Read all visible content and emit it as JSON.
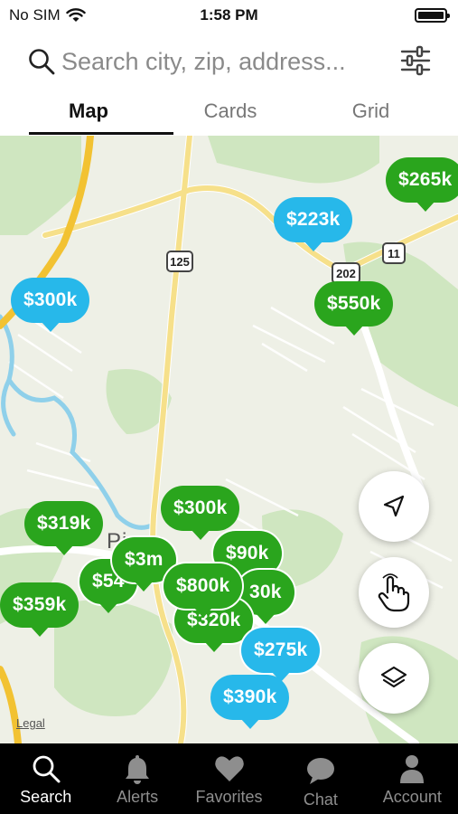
{
  "status_bar": {
    "carrier": "No SIM",
    "time": "1:58 PM",
    "battery_level": 0.9
  },
  "search": {
    "placeholder": "Search city, zip, address..."
  },
  "view_tabs": [
    {
      "label": "Map",
      "active": true
    },
    {
      "label": "Cards",
      "active": false
    },
    {
      "label": "Grid",
      "active": false
    }
  ],
  "map": {
    "place_label": "Pines",
    "legal": "Legal",
    "road_shields": [
      "125",
      "202",
      "11"
    ],
    "pins": [
      {
        "label": "$265k",
        "color": "green"
      },
      {
        "label": "$223k",
        "color": "blue"
      },
      {
        "label": "$300k",
        "color": "blue"
      },
      {
        "label": "$550k",
        "color": "green"
      },
      {
        "label": "$300k",
        "color": "green"
      },
      {
        "label": "$319k",
        "color": "green"
      },
      {
        "label": "$3m",
        "color": "green"
      },
      {
        "label": "$90k",
        "color": "green"
      },
      {
        "label": "$54",
        "color": "green"
      },
      {
        "label": "$800k",
        "color": "green"
      },
      {
        "label": "30k",
        "color": "green"
      },
      {
        "label": "$359k",
        "color": "green"
      },
      {
        "label": "$320k",
        "color": "green"
      },
      {
        "label": "$275k",
        "color": "blue"
      },
      {
        "label": "$390k",
        "color": "blue"
      }
    ]
  },
  "colors": {
    "green_pin": "#2aa51d",
    "blue_pin": "#27b8ea",
    "map_bg": "#eef0e6",
    "tabbar_bg": "#000000"
  },
  "bottom_nav": [
    {
      "label": "Search",
      "icon": "search-icon",
      "active": true
    },
    {
      "label": "Alerts",
      "icon": "bell-icon",
      "active": false
    },
    {
      "label": "Favorites",
      "icon": "heart-icon",
      "active": false
    },
    {
      "label": "Chat",
      "icon": "chat-bubble-icon",
      "active": false
    },
    {
      "label": "Account",
      "icon": "person-icon",
      "active": false
    }
  ]
}
